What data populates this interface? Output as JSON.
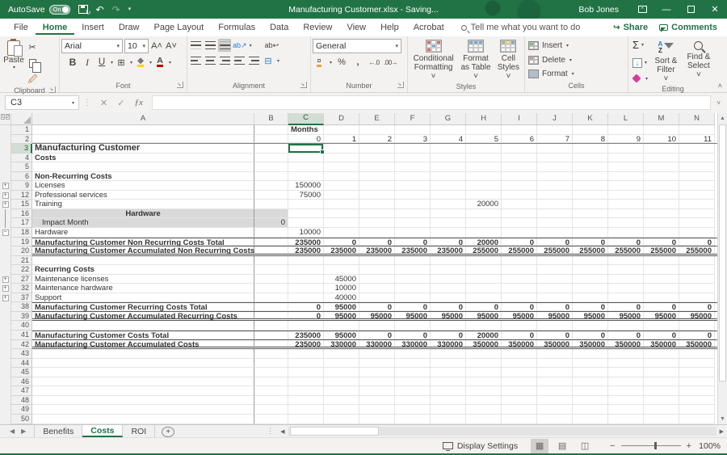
{
  "titlebar": {
    "autosave": "AutoSave",
    "autosave_state": "On",
    "title": "Manufacturing Customer.xlsx - Saving...",
    "user": "Bob Jones"
  },
  "menu": {
    "tabs": [
      "File",
      "Home",
      "Insert",
      "Draw",
      "Page Layout",
      "Formulas",
      "Data",
      "Review",
      "View",
      "Help",
      "Acrobat"
    ],
    "active": "Home",
    "tellme": "Tell me what you want to do",
    "share": "Share",
    "comments": "Comments"
  },
  "ribbon": {
    "clipboard": {
      "label": "Clipboard",
      "paste": "Paste"
    },
    "font": {
      "label": "Font",
      "name": "Arial",
      "size": "10"
    },
    "alignment": {
      "label": "Alignment"
    },
    "number": {
      "label": "Number",
      "format": "General"
    },
    "styles": {
      "label": "Styles",
      "buttons": [
        "Conditional Formatting ˅",
        "Format as Table ˅",
        "Cell Styles ˅"
      ]
    },
    "cells": {
      "label": "Cells",
      "buttons": [
        "Insert",
        "Delete",
        "Format"
      ]
    },
    "editing": {
      "label": "Editing",
      "sort": "Sort & Filter ˅",
      "find": "Find & Select ˅"
    }
  },
  "formula_bar": {
    "name_box": "C3",
    "formula": ""
  },
  "sheet": {
    "columns": [
      "A",
      "B",
      "C",
      "D",
      "E",
      "F",
      "G",
      "H",
      "I",
      "J",
      "K",
      "L",
      "M",
      "N"
    ],
    "selected": {
      "col": "C",
      "row": 3
    },
    "rows": [
      {
        "n": 1,
        "cl": "Months"
      },
      {
        "n": 2,
        "v": [
          "0",
          "1",
          "2",
          "3",
          "4",
          "5",
          "6",
          "7",
          "8",
          "9",
          "10",
          "11"
        ],
        "line": "under"
      },
      {
        "n": 3,
        "a": "Manufacturing Customer",
        "acls": "title"
      },
      {
        "n": 4,
        "a": "Costs",
        "acls": "bold"
      },
      {
        "n": 5
      },
      {
        "n": 6,
        "a": "Non-Recurring Costs",
        "acls": "bold"
      },
      {
        "n": 9,
        "a": "Licenses",
        "v": [
          "150000",
          "",
          "",
          "",
          "",
          "",
          "",
          "",
          "",
          "",
          "",
          ""
        ],
        "out": "+"
      },
      {
        "n": 12,
        "a": "Professional services",
        "v": [
          "75000",
          "",
          "",
          "",
          "",
          "",
          "",
          "",
          "",
          "",
          "",
          ""
        ],
        "out": "+"
      },
      {
        "n": 15,
        "a": "Training",
        "v": [
          "",
          "",
          "",
          "",
          "",
          "20000",
          "",
          "",
          "",
          "",
          "",
          ""
        ],
        "out": "+"
      },
      {
        "n": 16,
        "a": "Hardware",
        "acls": "bold center",
        "gray": true,
        "out": "|"
      },
      {
        "n": 17,
        "a": "Impact Month",
        "acls": "indent",
        "gray": true,
        "b": "0",
        "out": "|"
      },
      {
        "n": 18,
        "a": "Hardware",
        "v": [
          "10000",
          "",
          "",
          "",
          "",
          "",
          "",
          "",
          "",
          "",
          "",
          ""
        ],
        "out": "-"
      },
      {
        "n": 19,
        "a": "Manufacturing Customer Non Recurring Costs Total",
        "acls": "bold",
        "v": [
          "235000",
          "0",
          "0",
          "0",
          "0",
          "20000",
          "0",
          "0",
          "0",
          "0",
          "0",
          "0"
        ],
        "line": "total"
      },
      {
        "n": 20,
        "a": "Manufacturing Customer Accumulated Non Recurring Costs",
        "acls": "bold",
        "v": [
          "235000",
          "235000",
          "235000",
          "235000",
          "235000",
          "255000",
          "255000",
          "255000",
          "255000",
          "255000",
          "255000",
          "255000"
        ],
        "line": "accum"
      },
      {
        "n": 21
      },
      {
        "n": 22,
        "a": "Recurring Costs",
        "acls": "bold"
      },
      {
        "n": 27,
        "a": "Maintenance licenses",
        "v": [
          "",
          "45000",
          "",
          "",
          "",
          "",
          "",
          "",
          "",
          "",
          "",
          ""
        ],
        "out": "+"
      },
      {
        "n": 32,
        "a": "Maintenance hardware",
        "v": [
          "",
          "10000",
          "",
          "",
          "",
          "",
          "",
          "",
          "",
          "",
          "",
          ""
        ],
        "out": "+"
      },
      {
        "n": 37,
        "a": "Support",
        "v": [
          "",
          "40000",
          "",
          "",
          "",
          "",
          "",
          "",
          "",
          "",
          "",
          ""
        ],
        "out": "+"
      },
      {
        "n": 38,
        "a": "Manufacturing Customer Recurring Costs Total",
        "acls": "bold",
        "v": [
          "0",
          "95000",
          "0",
          "0",
          "0",
          "0",
          "0",
          "0",
          "0",
          "0",
          "0",
          "0"
        ],
        "line": "total"
      },
      {
        "n": 39,
        "a": "Manufacturing Customer Accumulated Recurring Costs",
        "acls": "bold",
        "v": [
          "0",
          "95000",
          "95000",
          "95000",
          "95000",
          "95000",
          "95000",
          "95000",
          "95000",
          "95000",
          "95000",
          "95000"
        ],
        "line": "accum"
      },
      {
        "n": 40
      },
      {
        "n": 41,
        "a": "Manufacturing Customer Costs Total",
        "acls": "bold",
        "v": [
          "235000",
          "95000",
          "0",
          "0",
          "0",
          "20000",
          "0",
          "0",
          "0",
          "0",
          "0",
          "0"
        ],
        "line": "total"
      },
      {
        "n": 42,
        "a": "Manufacturing Customer Accumulated Costs",
        "acls": "bold",
        "v": [
          "235000",
          "330000",
          "330000",
          "330000",
          "330000",
          "350000",
          "350000",
          "350000",
          "350000",
          "350000",
          "350000",
          "350000"
        ],
        "line": "accum"
      },
      {
        "n": 43
      },
      {
        "n": 44
      },
      {
        "n": 45
      },
      {
        "n": 46
      },
      {
        "n": 47
      },
      {
        "n": 48
      },
      {
        "n": 49
      },
      {
        "n": 50
      }
    ]
  },
  "sheet_tabs": {
    "tabs": [
      "Benefits",
      "Costs",
      "ROI"
    ],
    "active": "Costs"
  },
  "status": {
    "display_settings": "Display Settings",
    "zoom": "100%"
  }
}
